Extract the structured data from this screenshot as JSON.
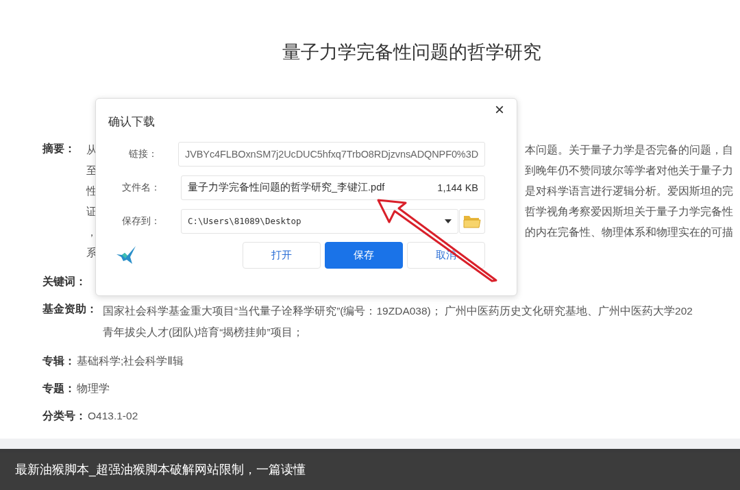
{
  "page": {
    "title": "量子力学完备性问题的哲学研究",
    "fields": [
      {
        "kind": "abstract",
        "label": "摘要：",
        "lines": [
          {
            "left": "从",
            "right": "本问题。关于量子力学是否完备的问题，自"
          },
          {
            "left": "至",
            "right": "到晚年仍不赞同玻尔等学者对他关于量子力"
          },
          {
            "left": "性",
            "right": "是对科学语言进行逻辑分析。爱因斯坦的完"
          },
          {
            "left": "证",
            "right": "哲学视角考察爱因斯坦关于量子力学完备性"
          },
          {
            "left": "，",
            "right": "的内在完备性、物理体系和物理实在的可描"
          },
          {
            "left": "系"
          }
        ]
      },
      {
        "kind": "plain",
        "label": "关键词："
      },
      {
        "kind": "multi",
        "label": "基金资助：",
        "lines": [
          "国家社会科学基金重大项目“当代量子诠释学研究”(编号：19ZDA038)； 广州中医药历史文化研究基地、广州中医药大学202",
          "青年拔尖人才(团队)培育“揭榜挂帅”项目；"
        ]
      },
      {
        "kind": "plain",
        "label": "专辑：",
        "value": "基础科学;社会科学Ⅱ辑"
      },
      {
        "kind": "plain",
        "label": "专题：",
        "value": "物理学"
      },
      {
        "kind": "plain",
        "label": "分类号：",
        "value": "O413.1-02"
      }
    ]
  },
  "dialog": {
    "title": "确认下载",
    "close": "×",
    "fields": [
      {
        "kind": "text",
        "label": "链接：",
        "value": "JVBYc4FLBOxnSM7j2UcDUC5hfxq7TrbO8RDjzvnsADQNPF0%3D"
      },
      {
        "kind": "file",
        "label": "文件名：",
        "value": "量子力学完备性问题的哲学研究_李键江.pdf",
        "size": "1,144 KB"
      },
      {
        "kind": "path",
        "label": "保存到：",
        "value": "C:\\Users\\81089\\Desktop"
      }
    ],
    "buttons": [
      {
        "label": "打开",
        "primary": false
      },
      {
        "label": "保存",
        "primary": true
      },
      {
        "label": "取消",
        "primary": false
      }
    ]
  },
  "caption": "最新油猴脚本_超强油猴脚本破解网站限制，一篇读懂"
}
